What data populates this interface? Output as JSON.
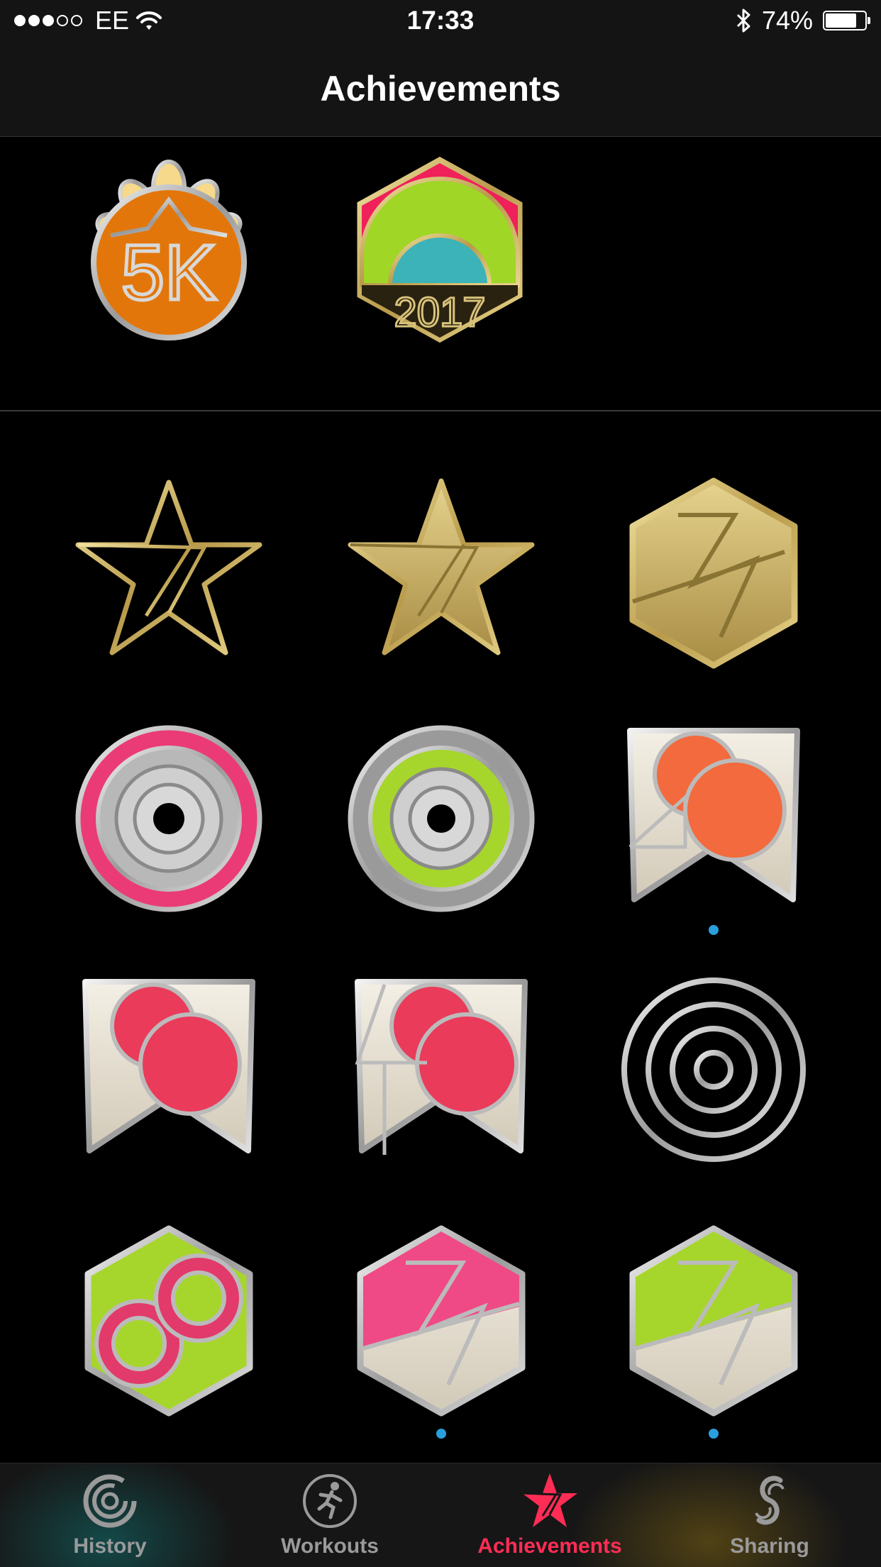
{
  "status_bar": {
    "carrier": "EE",
    "signal_bars_filled": 3,
    "signal_bars_total": 5,
    "time": "17:33",
    "battery_percent": "74%",
    "battery_level": 0.74,
    "icons": [
      "wifi-icon",
      "bluetooth-icon",
      "battery-icon"
    ]
  },
  "nav": {
    "title": "Achievements"
  },
  "sections": {
    "special": [
      {
        "name": "5k-badge",
        "text": "5K"
      },
      {
        "name": "2017-badge",
        "text": "2017"
      }
    ],
    "earned": [
      {
        "name": "star-outline-badge"
      },
      {
        "name": "star-gold-badge"
      },
      {
        "name": "gold-hexagon-badge"
      },
      {
        "name": "pink-ring-badge"
      },
      {
        "name": "green-ring-badge"
      },
      {
        "name": "20-badge",
        "new": true
      },
      {
        "name": "30-badge"
      },
      {
        "name": "40-badge"
      },
      {
        "name": "concentric-rings-badge"
      },
      {
        "name": "infinity-badge"
      },
      {
        "name": "pink-hexagon-badge",
        "new": true
      },
      {
        "name": "green-hexagon-badge",
        "new": true
      }
    ]
  },
  "tab_bar": {
    "tabs": [
      {
        "label": "History",
        "icon": "history-icon",
        "active": false
      },
      {
        "label": "Workouts",
        "icon": "workouts-icon",
        "active": false
      },
      {
        "label": "Achievements",
        "icon": "achievements-icon",
        "active": true
      },
      {
        "label": "Sharing",
        "icon": "sharing-icon",
        "active": false
      }
    ]
  },
  "colors": {
    "accent": "#ff2d55",
    "new_indicator": "#2a9fe0",
    "gold": "#d8c27a",
    "silver": "#c8c8c8"
  }
}
